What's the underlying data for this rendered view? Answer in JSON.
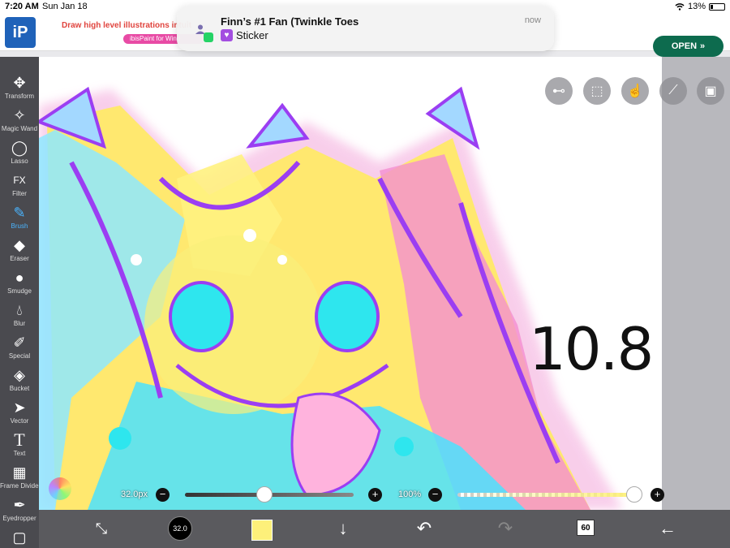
{
  "status": {
    "time": "7:20 AM",
    "date": "Sun Jan 18",
    "battery": "13%"
  },
  "ad": {
    "logo": "iP",
    "headline": "Draw high level illustrations intuit",
    "pill": "ibisPaint for Wind",
    "open_label": "OPEN"
  },
  "notification": {
    "title": "Finn’s #1 Fan (Twinkle Toes",
    "message": "Sticker",
    "time": "now"
  },
  "tools": [
    {
      "label": "Transform",
      "icon": "move-icon"
    },
    {
      "label": "Magic Wand",
      "icon": "magic-wand-icon"
    },
    {
      "label": "Lasso",
      "icon": "lasso-icon"
    },
    {
      "label": "Filter",
      "icon": "fx-icon"
    },
    {
      "label": "Brush",
      "icon": "brush-icon"
    },
    {
      "label": "Eraser",
      "icon": "eraser-icon"
    },
    {
      "label": "Smudge",
      "icon": "smudge-icon"
    },
    {
      "label": "Blur",
      "icon": "blur-icon"
    },
    {
      "label": "Special",
      "icon": "special-icon"
    },
    {
      "label": "Bucket",
      "icon": "bucket-icon"
    },
    {
      "label": "Vector",
      "icon": "vector-icon"
    },
    {
      "label": "Text",
      "icon": "text-icon"
    },
    {
      "label": "Frame Divider",
      "icon": "frame-divider-icon"
    },
    {
      "label": "Eyedropper",
      "icon": "eyedropper-icon"
    }
  ],
  "canvas_text": "10.8",
  "brush": {
    "size_label": "32.0px",
    "size_value": "32.0",
    "size_fraction": 0.47,
    "opacity_label": "100%",
    "opacity_fraction": 1.0
  },
  "color": "#fdf07a",
  "layers_count": "60",
  "colors": {
    "sidebar": "#4a4a4f",
    "accent": "#4ab5ff",
    "open_button": "#0d6b4e"
  }
}
